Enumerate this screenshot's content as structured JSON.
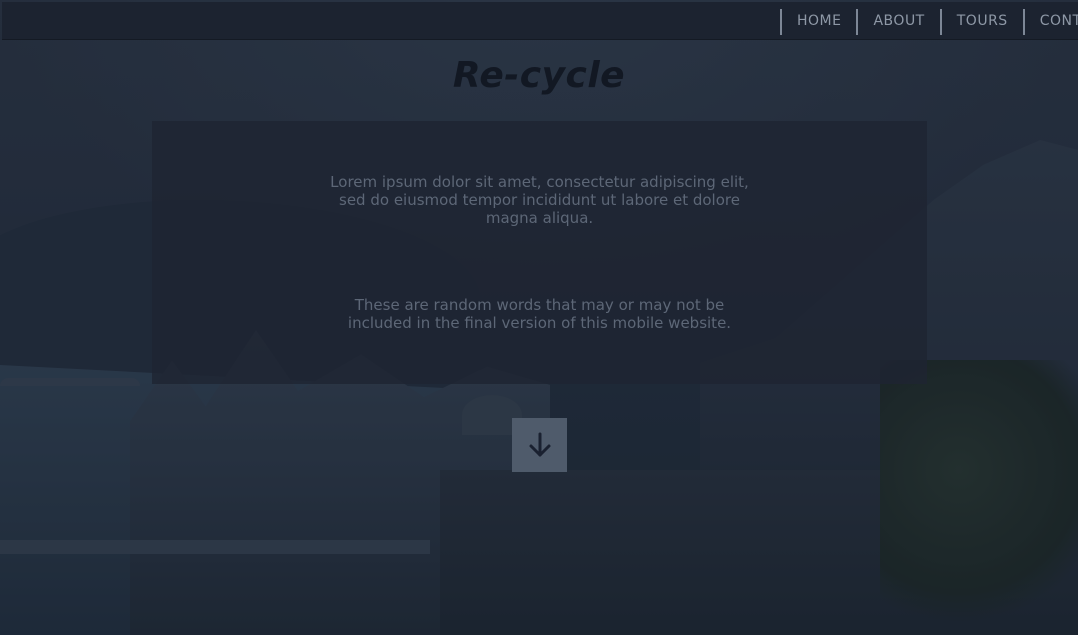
{
  "nav": {
    "items": [
      {
        "label": "HOME"
      },
      {
        "label": "ABOUT"
      },
      {
        "label": "TOURS"
      },
      {
        "label": "CONT"
      }
    ]
  },
  "hero": {
    "title": "Re-cycle",
    "paragraph_1": "Lorem ipsum dolor sit amet, consectetur adipiscing elit, sed do eiusmod tempor incididunt ut labore et dolore magna aliqua.",
    "paragraph_2": "These are random words that may or may not be included in the final version of this mobile website."
  },
  "scroll_button": {
    "icon": "arrow-down-icon"
  },
  "colors": {
    "navbar_bg": "#1c2330",
    "nav_text": "#8e98a6",
    "title_text": "#121823",
    "box_bg": "#1e2532",
    "box_text": "#5d6777",
    "button_bg": "#4f5b6b"
  }
}
